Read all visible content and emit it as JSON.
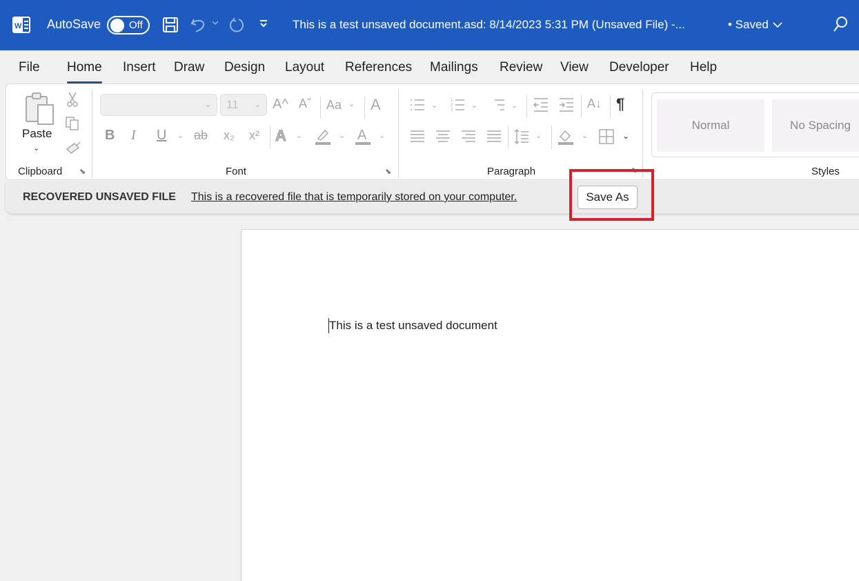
{
  "titlebar": {
    "autosave_label": "AutoSave",
    "autosave_state": "Off",
    "document_title": "This is a test unsaved document.asd: 8/14/2023 5:31 PM (Unsaved File)  -...",
    "save_state": "• Saved",
    "icons": [
      "word-logo-icon",
      "save-icon",
      "undo-icon",
      "redo-icon",
      "customize-qat-icon",
      "search-icon"
    ]
  },
  "tabs": [
    {
      "label": "File",
      "active": false
    },
    {
      "label": "Home",
      "active": true
    },
    {
      "label": "Insert",
      "active": false
    },
    {
      "label": "Draw",
      "active": false
    },
    {
      "label": "Design",
      "active": false
    },
    {
      "label": "Layout",
      "active": false
    },
    {
      "label": "References",
      "active": false
    },
    {
      "label": "Mailings",
      "active": false
    },
    {
      "label": "Review",
      "active": false
    },
    {
      "label": "View",
      "active": false
    },
    {
      "label": "Developer",
      "active": false
    },
    {
      "label": "Help",
      "active": false
    }
  ],
  "ribbon": {
    "clipboard": {
      "label": "Clipboard",
      "paste_label": "Paste",
      "icons": [
        "paste-icon",
        "cut-icon",
        "copy-icon",
        "format-painter-icon"
      ]
    },
    "font": {
      "label": "Font",
      "font_name": "",
      "font_size": "11",
      "case_label": "Aa",
      "buttons": {
        "bold": "B",
        "italic": "I",
        "underline": "U",
        "strikethrough": "ab",
        "subscript": "x₂",
        "superscript": "x²",
        "grow": "A^",
        "shrink": "Aˇ",
        "clear": "A",
        "effects": "A",
        "font_color": "A"
      }
    },
    "paragraph": {
      "label": "Paragraph",
      "sort": "A↓",
      "pilcrow": "¶"
    },
    "styles": {
      "label": "Styles",
      "items": [
        "Normal",
        "No Spacing"
      ]
    }
  },
  "message_bar": {
    "title": "RECOVERED UNSAVED FILE",
    "text": "This is a recovered file that is temporarily stored on your computer.",
    "button_label": "Save As",
    "highlight_color": "#d8202b"
  },
  "document": {
    "body_text": "This is a test unsaved document"
  },
  "colors": {
    "titlebar": "#1d5bbf",
    "background": "#f0f0f0",
    "highlight": "#d8202b"
  }
}
